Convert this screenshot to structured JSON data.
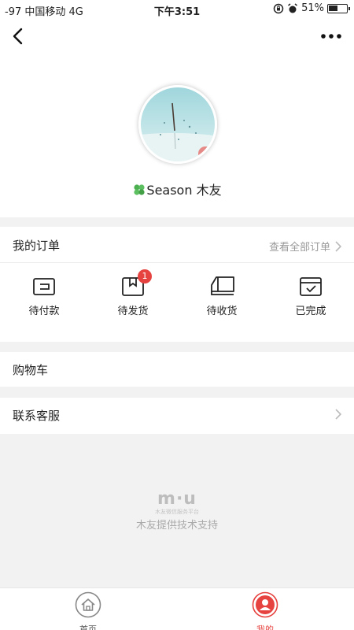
{
  "status_bar": {
    "carrier": "-97 中国移动   4G",
    "time": "下午3:51",
    "battery": "51%",
    "battery_level": 0.51
  },
  "profile": {
    "name_icon": "clover-icon",
    "username": "Season 木友"
  },
  "orders": {
    "title": "我的订单",
    "view_all": "查看全部订单",
    "items": [
      {
        "label": "待付款",
        "icon": "wallet-icon",
        "badge": ""
      },
      {
        "label": "待发货",
        "icon": "package-icon",
        "badge": "1"
      },
      {
        "label": "待收货",
        "icon": "truck-icon",
        "badge": ""
      },
      {
        "label": "已完成",
        "icon": "completed-icon",
        "badge": ""
      }
    ]
  },
  "menu": {
    "cart": "购物车",
    "service": "联系客服"
  },
  "footer": {
    "logo": "m·u",
    "logo_sub": "木友微信服务平台",
    "support": "木友提供技术支持"
  },
  "tabbar": {
    "home": "首页",
    "mine": "我的",
    "active_color": "#e64340"
  }
}
